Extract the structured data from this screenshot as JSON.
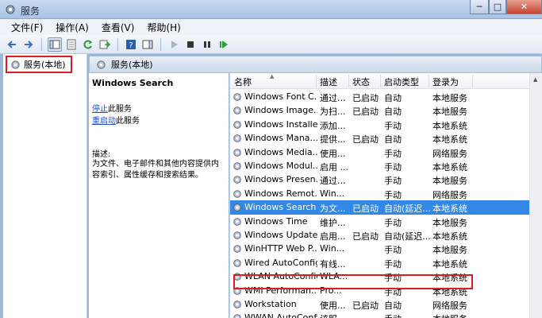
{
  "window": {
    "title": "服务",
    "min_label": "─",
    "max_label": "□",
    "close_label": "✕"
  },
  "menu": [
    "文件(F)",
    "操作(A)",
    "查看(V)",
    "帮助(H)"
  ],
  "tree": {
    "item": "服务(本地)"
  },
  "panel_header": "服务(本地)",
  "details": {
    "service_name": "Windows Search",
    "stop_link": "停止",
    "stop_suffix": "此服务",
    "restart_link": "重启动",
    "restart_suffix": "此服务",
    "desc_label": "描述:",
    "desc_text": "为文件、电子邮件和其他内容提供内容索引、属性缓存和搜索结果。"
  },
  "columns": {
    "name": "名称",
    "desc": "描述",
    "status": "状态",
    "startup": "启动类型",
    "logon": "登录为"
  },
  "services": [
    {
      "name": "Windows Font C...",
      "desc": "通过...",
      "status": "已启动",
      "startup": "自动",
      "logon": "本地服务"
    },
    {
      "name": "Windows Image...",
      "desc": "为扫...",
      "status": "已启动",
      "startup": "自动",
      "logon": "本地服务"
    },
    {
      "name": "Windows Installer",
      "desc": "添加...",
      "status": "",
      "startup": "手动",
      "logon": "本地系统"
    },
    {
      "name": "Windows Mana...",
      "desc": "提供...",
      "status": "已启动",
      "startup": "自动",
      "logon": "本地系统"
    },
    {
      "name": "Windows Media...",
      "desc": "使用...",
      "status": "",
      "startup": "手动",
      "logon": "网络服务"
    },
    {
      "name": "Windows Modul...",
      "desc": "启用 ...",
      "status": "",
      "startup": "手动",
      "logon": "本地系统"
    },
    {
      "name": "Windows Presen...",
      "desc": "通过...",
      "status": "",
      "startup": "手动",
      "logon": "本地服务"
    },
    {
      "name": "Windows Remot...",
      "desc": "Win...",
      "status": "",
      "startup": "手动",
      "logon": "网络服务"
    },
    {
      "name": "Windows Search",
      "desc": "为文...",
      "status": "已启动",
      "startup": "自动(延迟...",
      "logon": "本地系统"
    },
    {
      "name": "Windows Time",
      "desc": "维护...",
      "status": "",
      "startup": "手动",
      "logon": "本地服务"
    },
    {
      "name": "Windows Update",
      "desc": "启用...",
      "status": "已启动",
      "startup": "自动(延迟...",
      "logon": "本地系统"
    },
    {
      "name": "WinHTTP Web P...",
      "desc": "Win...",
      "status": "",
      "startup": "手动",
      "logon": "本地服务"
    },
    {
      "name": "Wired AutoConfig",
      "desc": "有线...",
      "status": "",
      "startup": "手动",
      "logon": "本地系统"
    },
    {
      "name": "WLAN AutoConfig",
      "desc": "WLA...",
      "status": "",
      "startup": "手动",
      "logon": "本地系统"
    },
    {
      "name": "WMI Performan...",
      "desc": "Pro...",
      "status": "",
      "startup": "手动",
      "logon": "本地系统"
    },
    {
      "name": "Workstation",
      "desc": "使用...",
      "status": "已启动",
      "startup": "自动",
      "logon": "网络服务"
    },
    {
      "name": "WWAN AutoConfig",
      "desc": "该服...",
      "status": "",
      "startup": "手动",
      "logon": "本地服务"
    }
  ],
  "selected_service": "Windows Search"
}
